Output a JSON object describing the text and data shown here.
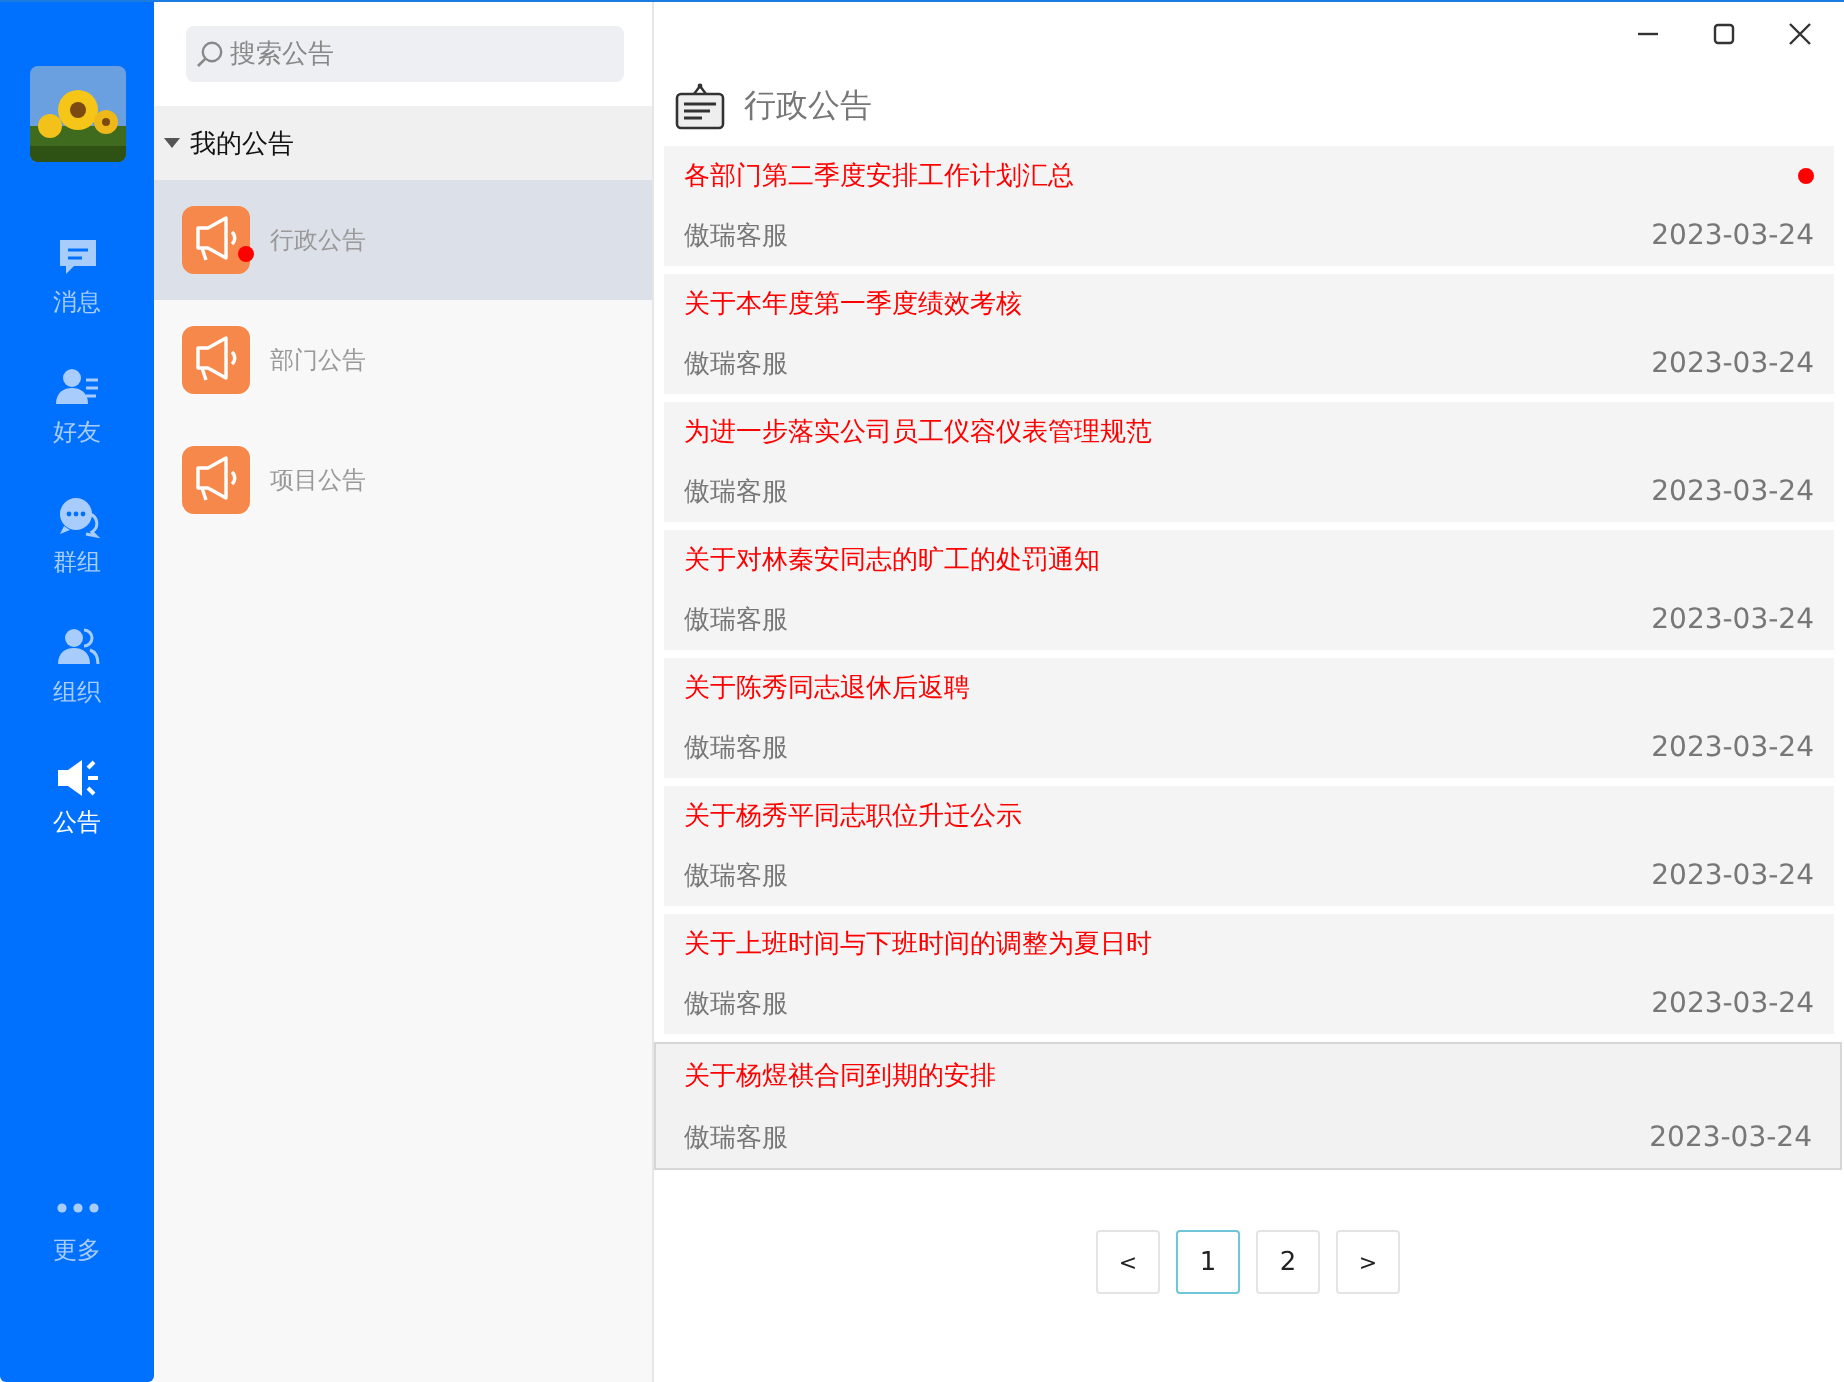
{
  "nav": {
    "items": [
      {
        "label": "消息",
        "kind": "message",
        "selected": false
      },
      {
        "label": "好友",
        "kind": "friends",
        "selected": false
      },
      {
        "label": "群组",
        "kind": "groups",
        "selected": false
      },
      {
        "label": "组织",
        "kind": "org",
        "selected": false
      },
      {
        "label": "公告",
        "kind": "notice",
        "selected": true
      }
    ],
    "more": {
      "label": "更多"
    }
  },
  "sidebar": {
    "search": {
      "placeholder": "搜索公告"
    },
    "group": {
      "label": "我的公告",
      "expanded": true,
      "items": [
        {
          "label": "行政公告",
          "selected": true,
          "unread": true
        },
        {
          "label": "部门公告",
          "selected": false,
          "unread": false
        },
        {
          "label": "项目公告",
          "selected": false,
          "unread": false
        }
      ]
    }
  },
  "content": {
    "title": "行政公告",
    "notices": [
      {
        "title": "各部门第二季度安排工作计划汇总",
        "author": "傲瑞客服",
        "date": "2023-03-24",
        "unread": true,
        "hovered": false
      },
      {
        "title": "关于本年度第一季度绩效考核",
        "author": "傲瑞客服",
        "date": "2023-03-24",
        "unread": false,
        "hovered": false
      },
      {
        "title": "为进一步落实公司员工仪容仪表管理规范",
        "author": "傲瑞客服",
        "date": "2023-03-24",
        "unread": false,
        "hovered": false
      },
      {
        "title": "关于对林秦安同志的旷工的处罚通知",
        "author": "傲瑞客服",
        "date": "2023-03-24",
        "unread": false,
        "hovered": false
      },
      {
        "title": "关于陈秀同志退休后返聘",
        "author": "傲瑞客服",
        "date": "2023-03-24",
        "unread": false,
        "hovered": false
      },
      {
        "title": "关于杨秀平同志职位升迁公示",
        "author": "傲瑞客服",
        "date": "2023-03-24",
        "unread": false,
        "hovered": false
      },
      {
        "title": "关于上班时间与下班时间的调整为夏日时",
        "author": "傲瑞客服",
        "date": "2023-03-24",
        "unread": false,
        "hovered": false
      },
      {
        "title": "关于杨煜祺合同到期的安排",
        "author": "傲瑞客服",
        "date": "2023-03-24",
        "unread": false,
        "hovered": true
      }
    ],
    "pagination": [
      {
        "label": "<",
        "kind": "prev",
        "selected": false
      },
      {
        "label": "1",
        "kind": "page",
        "selected": true
      },
      {
        "label": "2",
        "kind": "page",
        "selected": false
      },
      {
        "label": ">",
        "kind": "next",
        "selected": false
      }
    ]
  }
}
